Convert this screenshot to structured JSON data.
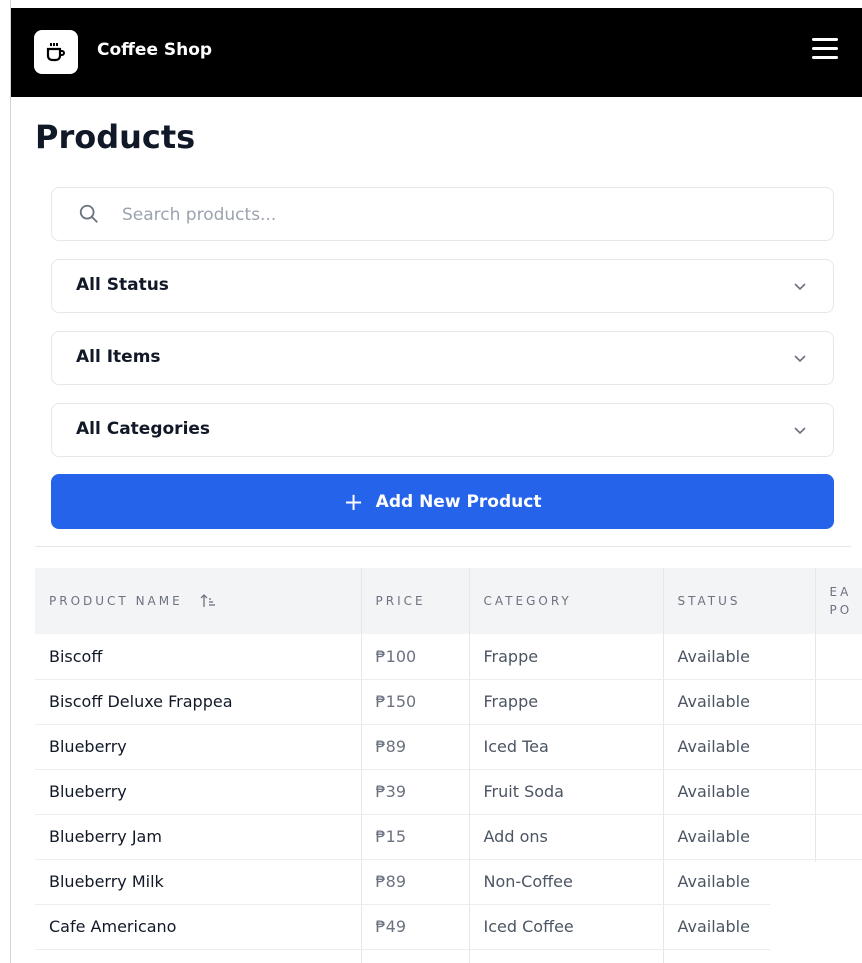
{
  "header": {
    "app_title": "Coffee Shop",
    "logo_icon": "coffee-cup-icon",
    "menu_icon": "hamburger-menu-icon"
  },
  "page": {
    "title": "Products"
  },
  "search": {
    "placeholder": "Search products...",
    "value": ""
  },
  "filters": [
    {
      "selected": "All Status"
    },
    {
      "selected": "All Items"
    },
    {
      "selected": "All Categories"
    }
  ],
  "add_button": {
    "label": "Add New Product",
    "color": "#2563eb"
  },
  "table": {
    "columns": [
      "PRODUCT NAME",
      "PRICE",
      "CATEGORY",
      "STATUS",
      "EA PO"
    ],
    "rows": [
      {
        "name": "Biscoff",
        "price": "₱100",
        "category": "Frappe",
        "status": "Available"
      },
      {
        "name": "Biscoff Deluxe Frappea",
        "price": "₱150",
        "category": "Frappe",
        "status": "Available"
      },
      {
        "name": "Blueberry",
        "price": "₱89",
        "category": "Iced Tea",
        "status": "Available"
      },
      {
        "name": "Blueberry",
        "price": "₱39",
        "category": "Fruit Soda",
        "status": "Available"
      },
      {
        "name": "Blueberry Jam",
        "price": "₱15",
        "category": "Add ons",
        "status": "Available"
      },
      {
        "name": "Blueberry Milk",
        "price": "₱89",
        "category": "Non-Coffee",
        "status": "Available"
      },
      {
        "name": "Cafe Americano",
        "price": "₱49",
        "category": "Iced Coffee",
        "status": "Available"
      }
    ]
  }
}
